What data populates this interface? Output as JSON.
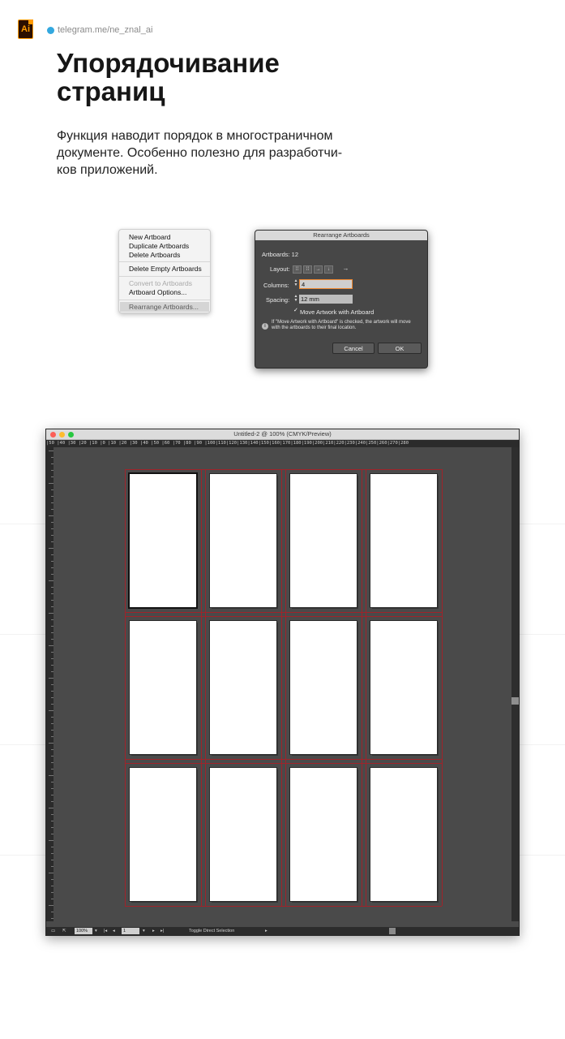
{
  "header": {
    "logo_text": "Ai",
    "channel_link": "telegram.me/ne_znal_ai",
    "title_lines": [
      "Упорядочивание",
      "страниц"
    ],
    "description_lines": [
      "Функция наводит порядок в многостраничном",
      "документе. Особенно полезно для разработчи-",
      "ков приложений."
    ]
  },
  "context_menu": {
    "items": [
      {
        "label": "New Artboard",
        "enabled": true
      },
      {
        "label": "Duplicate Artboards",
        "enabled": true
      },
      {
        "label": "Delete Artboards",
        "enabled": true
      },
      {
        "label": "Delete Empty Artboards",
        "enabled": true
      },
      {
        "label": "Convert to Artboards",
        "enabled": false
      },
      {
        "label": "Artboard Options...",
        "enabled": true
      },
      {
        "label": "Rearrange Artboards...",
        "enabled": true,
        "highlighted": true
      }
    ]
  },
  "dialog": {
    "title": "Rearrange Artboards",
    "artboards_label": "Artboards: 12",
    "layout_label": "Layout:",
    "columns_label": "Columns:",
    "columns_value": "4",
    "spacing_label": "Spacing:",
    "spacing_value": "12 mm",
    "move_artwork_label": "Move Artwork with Artboard",
    "move_artwork_checked": true,
    "info_lines": [
      "If \"Move Artwork with Artboard\" is checked, the artwork will move",
      "with the artboards to their final location."
    ],
    "cancel_label": "Cancel",
    "ok_label": "OK"
  },
  "document": {
    "window_title": "Untitled-2 @ 100% (CMYK/Preview)",
    "ruler_top_text": "|50 |40 |30 |20 |10 |0  |10 |20 |30 |40 |50 |60 |70 |80 |90 |100|110|120|130|140|150|160|170|180|190|200|210|220|230|240|250|260|270|280",
    "zoom_value": "100%",
    "artboard_number": "1",
    "status_text": "Toggle Direct Selection",
    "artboard_count": 12,
    "columns": 4,
    "active_artboard": 1
  },
  "colors": {
    "accent_focus": "#f08a32",
    "bleed_line": "#a0232a",
    "canvas": "#4a4a4a",
    "telegram": "#33a8df",
    "ai_orange": "#ff9a00"
  }
}
